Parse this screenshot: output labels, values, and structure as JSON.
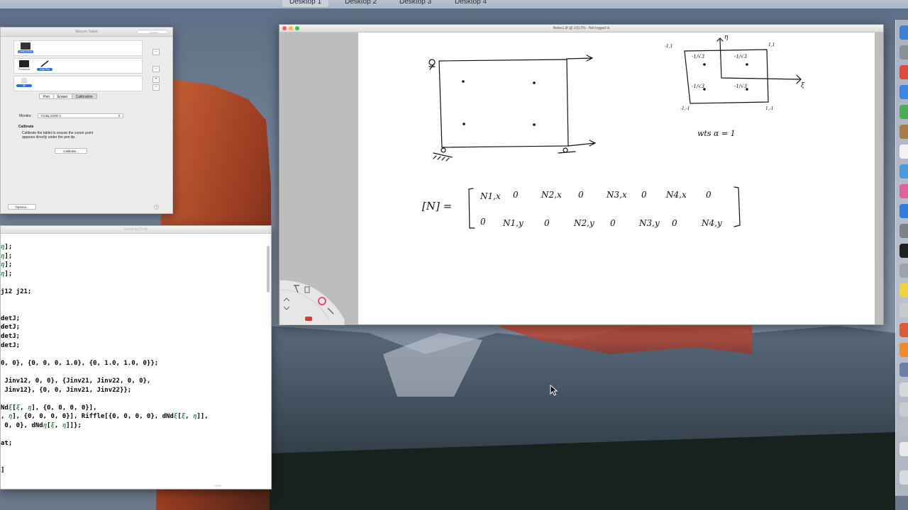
{
  "spaces": [
    {
      "label": "Desktop 1",
      "active": true
    },
    {
      "label": "Desktop 2",
      "active": false
    },
    {
      "label": "Desktop 3",
      "active": false
    },
    {
      "label": "Desktop 4",
      "active": false
    }
  ],
  "wacom": {
    "title": "Wacom Tablet",
    "search_placeholder": "Search",
    "tablet_caption": "Cintiq 13HD",
    "tool_caption_1": "Functions",
    "tool_caption_2": "Grip Pen",
    "app_caption": "All",
    "tabs": [
      {
        "label": "Pen",
        "active": false
      },
      {
        "label": "Eraser",
        "active": false
      },
      {
        "label": "Calibration",
        "active": true
      }
    ],
    "monitor_label": "Monitor:",
    "monitor_value": "Cintiq 13HD 1",
    "calibrate_heading": "Calibrate",
    "calibrate_desc_1": "Calibrate the tablet to ensure the cursor point",
    "calibrate_desc_2": "appears directly under the pen tip.",
    "calibrate_button": "Calibrate...",
    "options_button": "Options...",
    "help_glyph": "?"
  },
  "notebook": {
    "title": "Elasticity2D.nb",
    "zoom": "100%",
    "lines": [
      [
        {
          "t": ""
        },
        {
          "t": "η",
          "g": true
        },
        {
          "t": "];"
        }
      ],
      [
        {
          "t": ""
        },
        {
          "t": "η",
          "g": true
        },
        {
          "t": "];"
        }
      ],
      [
        {
          "t": ""
        },
        {
          "t": "η",
          "g": true
        },
        {
          "t": "];"
        }
      ],
      [
        {
          "t": ""
        },
        {
          "t": "η",
          "g": true
        },
        {
          "t": "];"
        }
      ],
      [
        {
          "t": ""
        }
      ],
      [
        {
          "t": "j12 j21;"
        }
      ],
      [
        {
          "t": ""
        }
      ],
      [
        {
          "t": ""
        }
      ],
      [
        {
          "t": "detJ;"
        }
      ],
      [
        {
          "t": "detJ;"
        }
      ],
      [
        {
          "t": "detJ;"
        }
      ],
      [
        {
          "t": "detJ;"
        }
      ],
      [
        {
          "t": ""
        }
      ],
      [
        {
          "t": "0, 0}, {0, 0, 0, 1.0}, {0, 1.0, 1.0, 0}};"
        }
      ],
      [
        {
          "t": ""
        }
      ],
      [
        {
          "t": " Jinv12, 0, 0}, {Jinv21, Jinv22, 0, 0},"
        }
      ],
      [
        {
          "t": " Jinv12}, {0, 0, Jinv21, Jinv22}};"
        }
      ],
      [
        {
          "t": ""
        }
      ],
      [
        {
          "t": "Nd"
        },
        {
          "t": "ξ",
          "g": true
        },
        {
          "t": "["
        },
        {
          "t": "ξ",
          "g": true
        },
        {
          "t": ", "
        },
        {
          "t": "η",
          "g": true
        },
        {
          "t": "], {0, 0, 0, 0}],"
        }
      ],
      [
        {
          "t": ", "
        },
        {
          "t": "η",
          "g": true
        },
        {
          "t": "], {0, 0, 0, 0}], Riffle[{0, 0, 0, 0}, dNd"
        },
        {
          "t": "ξ",
          "g": true
        },
        {
          "t": "["
        },
        {
          "t": "ξ",
          "g": true
        },
        {
          "t": ", "
        },
        {
          "t": "η",
          "g": true
        },
        {
          "t": "]],"
        }
      ],
      [
        {
          "t": " 0, 0}, dNd"
        },
        {
          "t": "η",
          "g": true
        },
        {
          "t": "["
        },
        {
          "t": "ξ",
          "g": true
        },
        {
          "t": ", "
        },
        {
          "t": "η",
          "g": true
        },
        {
          "t": "]]};"
        }
      ],
      [
        {
          "t": ""
        }
      ],
      [
        {
          "t": "at;"
        }
      ],
      [
        {
          "t": ""
        }
      ],
      [
        {
          "t": ""
        }
      ],
      [
        {
          "t": "]"
        }
      ]
    ]
  },
  "notes": {
    "title": "Notes1.tif @ 103.2% - Not logged in",
    "sketch": {
      "matrix_label": "[N] =",
      "row1": [
        "N1,x",
        "0",
        "N2,x",
        "0",
        "N3,x",
        "0",
        "N4,x",
        "0"
      ],
      "row2": [
        "0",
        "N1,y",
        "0",
        "N2,y",
        "0",
        "N3,y",
        "0",
        "N4,y"
      ],
      "corner_tl": "-1,1",
      "corner_tr": "1,1",
      "corner_bl": "-1,-1",
      "corner_br": "1,-1",
      "axis_eta": "η",
      "axis_xi": "ξ",
      "gauss_label": "-1/√3",
      "weights_note": "wts α = 1"
    }
  },
  "colors": {
    "accent": "#2f6fd8",
    "code_symbol": "#3f8f50"
  }
}
